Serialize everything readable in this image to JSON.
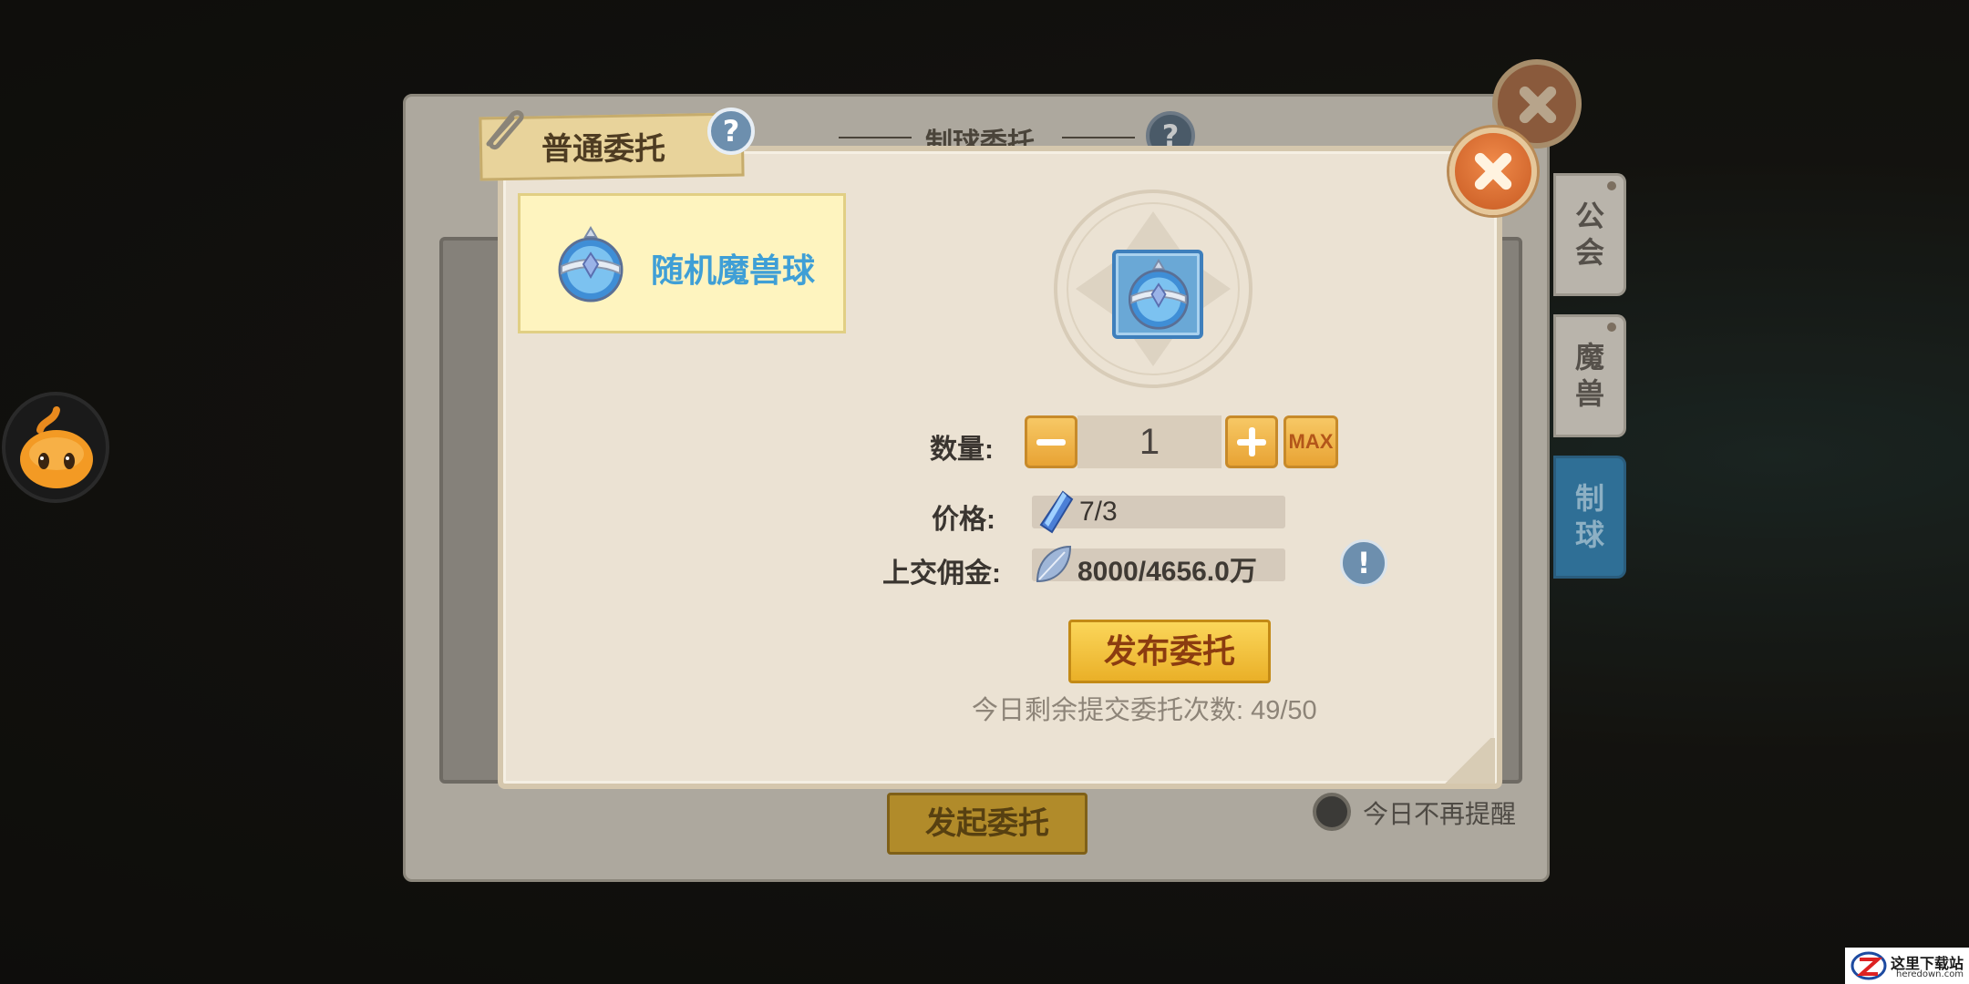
{
  "back_panel": {
    "title": "制球委托",
    "issue_button": "发起委托",
    "dont_remind": "今日不再提醒"
  },
  "side_tabs": [
    {
      "label": "公\n会",
      "active": false
    },
    {
      "label": "魔\n兽",
      "active": false
    },
    {
      "label": "制\n球",
      "active": true
    }
  ],
  "dialog": {
    "tag_title": "普通委托",
    "item_name": "随机魔兽球",
    "quantity_label": "数量:",
    "quantity_value": "1",
    "max_label": "MAX",
    "price_label": "价格:",
    "price_value": "7/3",
    "commission_label": "上交佣金:",
    "commission_value": "8000/4656.0万",
    "publish_button": "发布委托",
    "remaining_text": "今日剩余提交委托次数: 49/50"
  },
  "watermark": {
    "text": "这里下载站",
    "sub": "heredown.com"
  },
  "colors": {
    "accent_orange": "#e8a334",
    "item_blue": "#3f9fd6",
    "active_tab": "#2f6f96"
  }
}
